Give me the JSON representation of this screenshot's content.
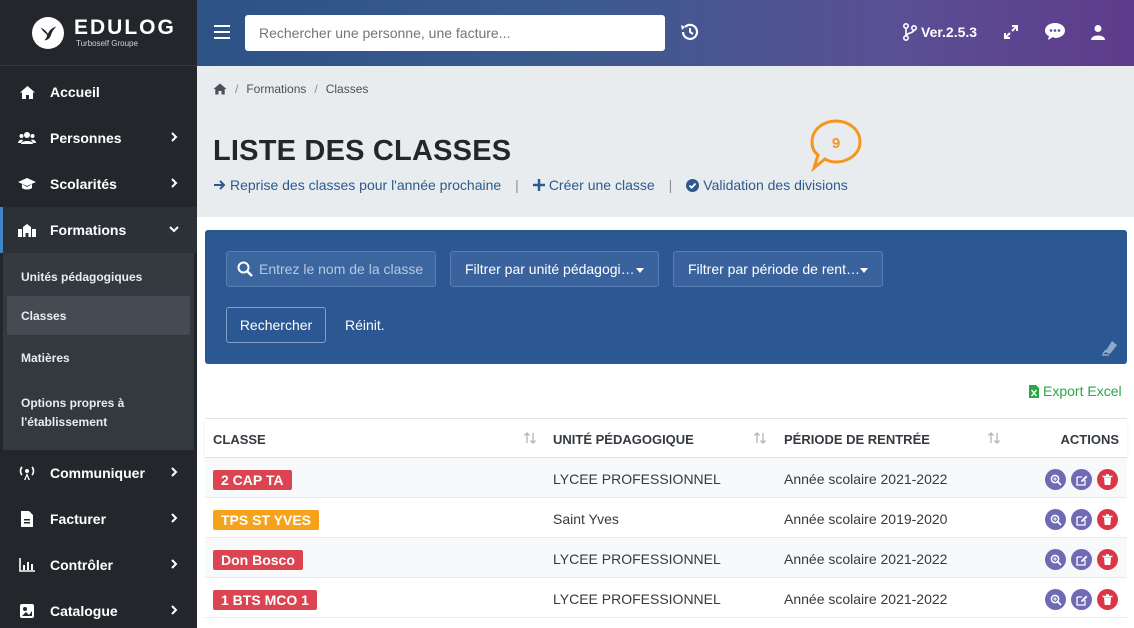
{
  "brand": {
    "name": "EDULOG",
    "sub": "Turboself Groupe"
  },
  "sidebar": {
    "items": [
      {
        "label": "Accueil",
        "icon": "home-icon"
      },
      {
        "label": "Personnes",
        "icon": "users-icon"
      },
      {
        "label": "Scolarités",
        "icon": "graduation-cap-icon"
      },
      {
        "label": "Formations",
        "icon": "school-icon"
      },
      {
        "label": "Communiquer",
        "icon": "broadcast-icon"
      },
      {
        "label": "Facturer",
        "icon": "invoice-icon"
      },
      {
        "label": "Contrôler",
        "icon": "chart-icon"
      },
      {
        "label": "Catalogue",
        "icon": "catalogue-icon"
      }
    ],
    "submenu": [
      {
        "label": "Unités pédagogiques"
      },
      {
        "label": "Classes"
      },
      {
        "label": "Matières"
      },
      {
        "label": "Options propres à l'établissement"
      }
    ]
  },
  "topbar": {
    "search_placeholder": "Rechercher une personne, une facture...",
    "version": "Ver.2.5.3"
  },
  "breadcrumb": [
    "Formations",
    "Classes"
  ],
  "page": {
    "title": "LISTE DES CLASSES",
    "actions": {
      "reprise": "Reprise des classes pour l'année prochaine",
      "creer": "Créer une classe",
      "validation": "Validation des divisions"
    },
    "bubble_count": "9"
  },
  "filters": {
    "name_placeholder": "Entrez le nom de la classe",
    "unit_select": "Filtrer par unité pédagogi…",
    "period_select": "Filtrer par période de rent…",
    "search_button": "Rechercher",
    "reset_button": "Réinit."
  },
  "export_label": "Export Excel",
  "table": {
    "headers": {
      "classe": "CLASSE",
      "unite": "UNITÉ PÉDAGOGIQUE",
      "periode": "PÉRIODE DE RENTRÉE",
      "actions": "ACTIONS"
    },
    "rows": [
      {
        "classe": "2 CAP TA",
        "color": "#dc4451",
        "unite": "LYCEE PROFESSIONNEL",
        "periode": "Année scolaire 2021-2022"
      },
      {
        "classe": "TPS ST YVES",
        "color": "#f7a21b",
        "unite": "Saint Yves",
        "periode": "Année scolaire 2019-2020"
      },
      {
        "classe": "Don Bosco",
        "color": "#dc4451",
        "unite": "LYCEE PROFESSIONNEL",
        "periode": "Année scolaire 2021-2022"
      },
      {
        "classe": "1 BTS MCO 1",
        "color": "#dc4451",
        "unite": "LYCEE PROFESSIONNEL",
        "periode": "Année scolaire 2021-2022"
      }
    ]
  },
  "colors": {
    "sidebar": "#23272b",
    "filter_panel": "#2b5792",
    "accent": "#2c5a8e",
    "bubble": "#f7941d"
  }
}
